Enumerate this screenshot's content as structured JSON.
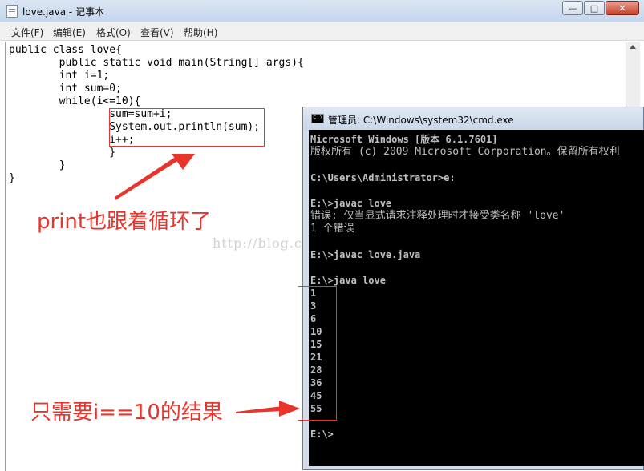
{
  "notepad": {
    "title": "love.java - 记事本",
    "window_buttons": {
      "minimize": "—",
      "maximize": "□",
      "close": "✕"
    },
    "menu": [
      "文件(F)",
      "编辑(E)",
      "格式(O)",
      "查看(V)",
      "帮助(H)"
    ],
    "code_lines": [
      "public class love{",
      "        public static void main(String[] args){",
      "        int i=1;",
      "        int sum=0;",
      "        while(i<=10){",
      "                sum=sum+i;",
      "                System.out.println(sum);",
      "                i++;",
      "                }",
      "        }",
      "}"
    ]
  },
  "annotations": {
    "print_note": "print也跟着循环了",
    "result_note": "只需要i==10的结果",
    "watermark": "http://blog.csdn.net/yowukowu"
  },
  "cmd": {
    "title": "管理员: C:\\Windows\\system32\\cmd.exe",
    "lines": [
      "Microsoft Windows [版本 6.1.7601]",
      "版权所有 (c) 2009 Microsoft Corporation。保留所有权利",
      "",
      "C:\\Users\\Administrator>e:",
      "",
      "E:\\>javac love",
      "错误: 仅当显式请求注释处理时才接受类名称 'love'",
      "1 个错误",
      "",
      "E:\\>javac love.java",
      "",
      "E:\\>java love",
      "1",
      "3",
      "6",
      "10",
      "15",
      "21",
      "28",
      "36",
      "45",
      "55",
      "",
      "E:\\>"
    ]
  },
  "colors": {
    "annotation_red": "#e8342b",
    "console_bg": "#000000",
    "console_text": "#c0c0c0"
  }
}
